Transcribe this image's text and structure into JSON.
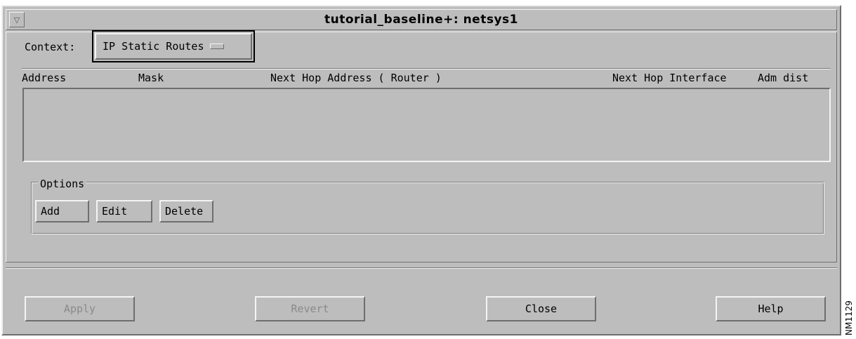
{
  "window": {
    "title": "tutorial_baseline+: netsys1",
    "menu_icon": "triangle-down-icon"
  },
  "context": {
    "label": "Context:",
    "selected": "IP Static Routes"
  },
  "table": {
    "columns": [
      "Address",
      "Mask",
      "Next Hop Address ( Router )",
      "Next Hop Interface",
      "Adm dist"
    ],
    "rows": []
  },
  "options": {
    "label": "Options",
    "add": "Add",
    "edit": "Edit",
    "delete": "Delete"
  },
  "footer": {
    "apply": "Apply",
    "revert": "Revert",
    "close": "Close",
    "help": "Help"
  },
  "figure_code": "NM1129",
  "colors": {
    "background": "#bdbdbd",
    "highlight": "#f4f4f4",
    "shadow": "#6e6e6e",
    "disabled_text": "#8a8a8a"
  }
}
